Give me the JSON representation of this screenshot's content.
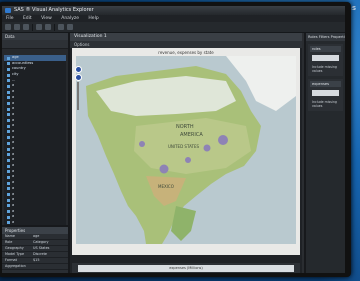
{
  "window": {
    "title": "SAS ® Visual Analytics Explorer"
  },
  "menu": [
    "File",
    "Edit",
    "View",
    "Analyze",
    "Help"
  ],
  "left_panel": {
    "header": "Data",
    "items": [
      "age",
      "accountless",
      "country",
      "city",
      "...",
      "a",
      "a",
      "a",
      "a",
      "a",
      "a",
      "a",
      "a",
      "a",
      "a",
      "a",
      "a",
      "a",
      "a",
      "a",
      "a",
      "a",
      "a",
      "a",
      "a",
      "a",
      "a",
      "a",
      "a",
      "a",
      "a",
      "a",
      "a"
    ],
    "properties_header": "Properties",
    "properties": [
      {
        "k": "Name",
        "v": "age"
      },
      {
        "k": "Role",
        "v": "Category"
      },
      {
        "k": "Geography",
        "v": "US States"
      },
      {
        "k": "Model Type",
        "v": "Discrete"
      },
      {
        "k": "Format",
        "v": "$15"
      },
      {
        "k": "Aggregation",
        "v": ""
      }
    ]
  },
  "visualization": {
    "tab": "Visualization 1",
    "options_label": "Options",
    "chart_title": "revenue, expenses by state",
    "legend_label": "expenses (Millions)",
    "map": {
      "labels": [
        "NORTH",
        "AMERICA",
        "UNITED STATES",
        "MEXICO"
      ],
      "bubbles": [
        {
          "state": "Pacific NW",
          "value": 1
        },
        {
          "state": "California",
          "value": 2
        },
        {
          "state": "Texas",
          "value": 1
        },
        {
          "state": "Great Lakes",
          "value": 2
        },
        {
          "state": "Northeast",
          "value": 3
        }
      ]
    }
  },
  "right_panel": {
    "tabs": "Roles  Filters  Properties",
    "sections": [
      {
        "title": "roles",
        "checkbox": "Include missing values"
      },
      {
        "title": "expenses",
        "checkbox": "Include missing values"
      }
    ]
  },
  "brand": {
    "text": "sas"
  }
}
